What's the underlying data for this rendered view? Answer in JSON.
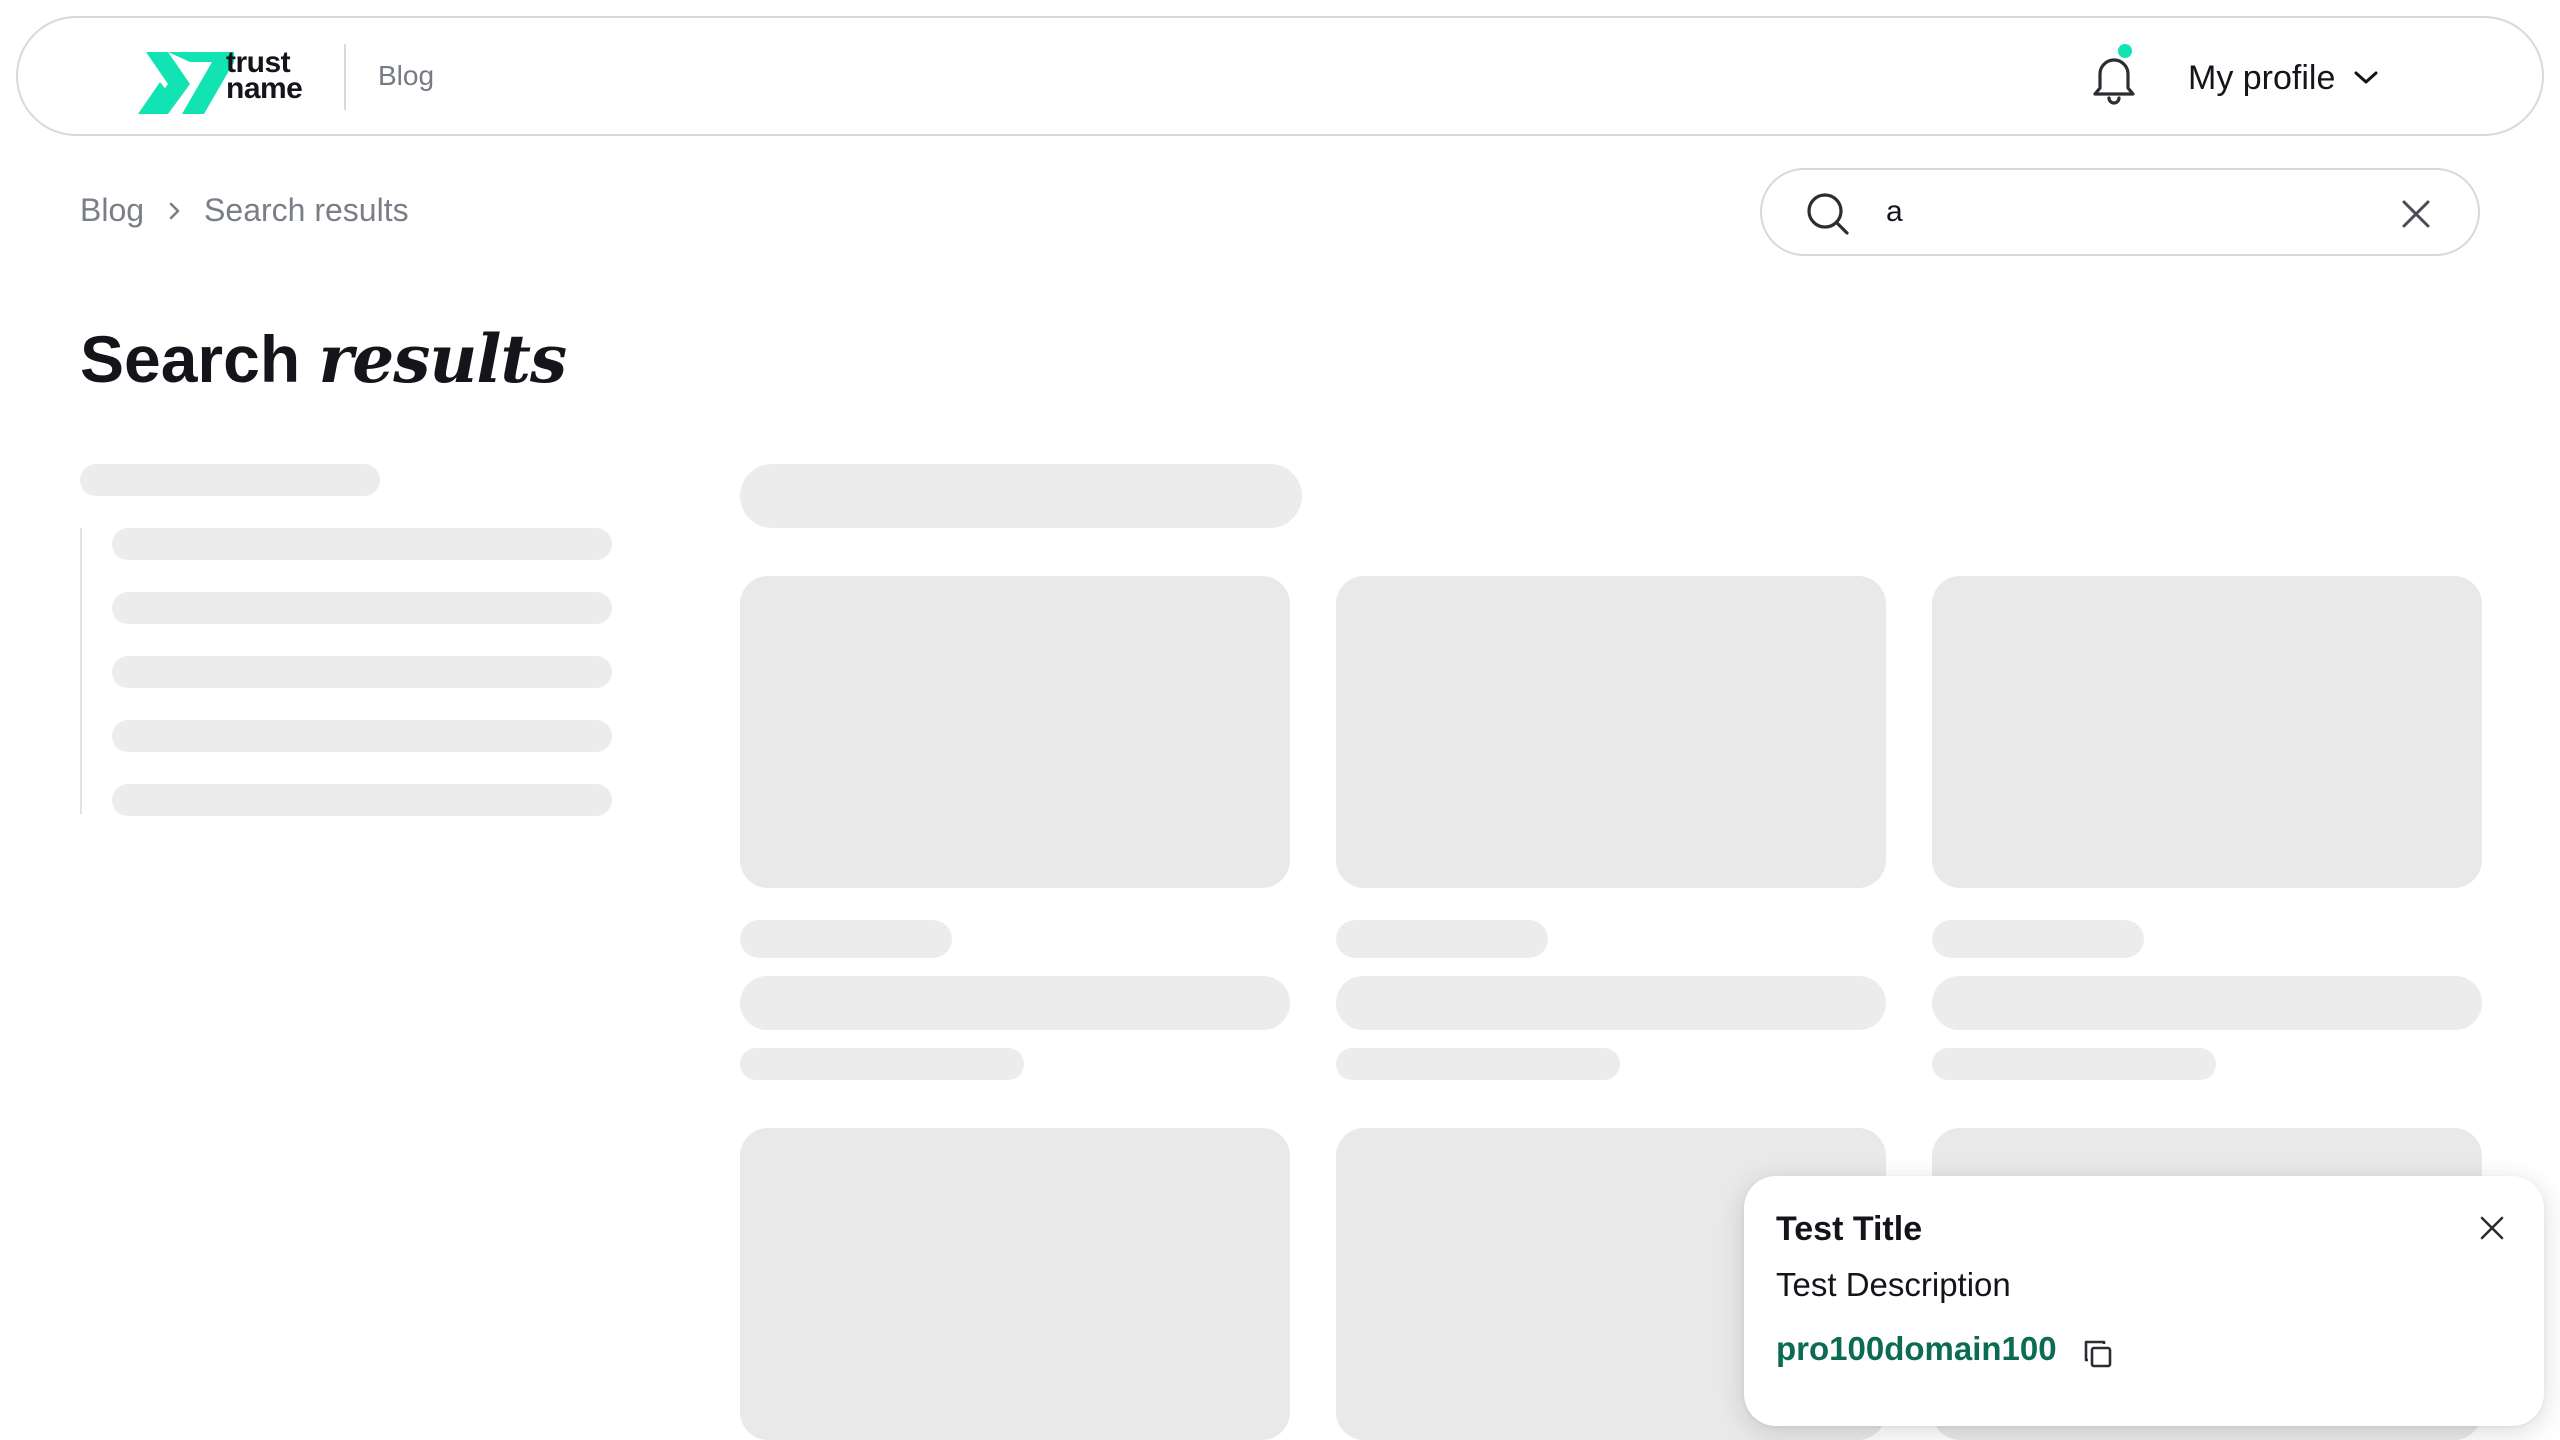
{
  "brand": {
    "logo_line1": "trust",
    "logo_line2": "name",
    "section": "Blog",
    "accent_color": "#12e3b2"
  },
  "header": {
    "profile_label": "My profile",
    "notification_icon": "bell-icon",
    "has_unread_notifications": true
  },
  "breadcrumb": {
    "items": [
      "Blog",
      "Search results"
    ]
  },
  "search": {
    "value": "a"
  },
  "page": {
    "title_regular": "Search",
    "title_italic": "results"
  },
  "toast": {
    "title": "Test Title",
    "description": "Test Description",
    "link": "pro100domain100",
    "link_color": "#0c6b53"
  }
}
